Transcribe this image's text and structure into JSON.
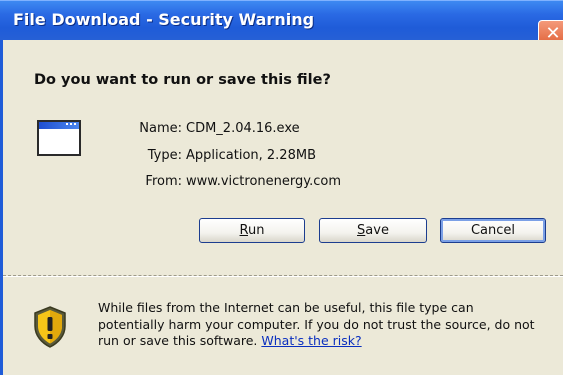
{
  "window": {
    "title": "File Download - Security Warning",
    "close_label": "✕"
  },
  "dialog": {
    "question": "Do you want to run or save this file?",
    "file_info": {
      "name_label": "Name:",
      "name_value": "CDM_2.04.16.exe",
      "type_label": "Type:",
      "type_value": "Application, 2.28MB",
      "from_label": "From:",
      "from_value": "www.victronenergy.com"
    },
    "buttons": {
      "run_mnemonic": "R",
      "run_rest": "un",
      "save_mnemonic": "S",
      "save_rest": "ave",
      "cancel_label": "Cancel"
    },
    "warning": {
      "line1": "While files from the Internet can be useful, this file type can",
      "line2": "potentially harm your computer. If you do not trust the source, do not",
      "line3_prefix": "run or save this software.",
      "risk_link": "What's the risk?"
    }
  },
  "icons": {
    "app": "application-window-icon",
    "shield": "security-shield-warning-icon"
  },
  "colors": {
    "titlebar": "#2a6ae4",
    "close_button": "#de5a2f",
    "link": "#0a2fbf",
    "shield_yellow": "#f5c518"
  }
}
